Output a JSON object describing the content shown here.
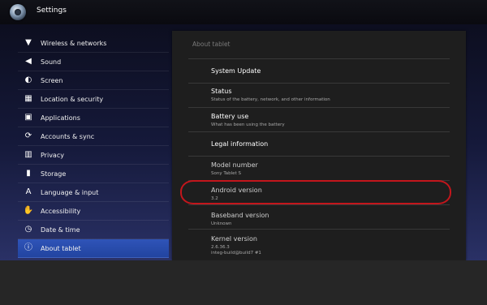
{
  "app": {
    "title": "Settings",
    "icon": "settings-gear-icon"
  },
  "sidebar": {
    "items": [
      {
        "label": "Wireless & networks",
        "icon": "wifi-icon",
        "glyph": "▼"
      },
      {
        "label": "Sound",
        "icon": "speaker-icon",
        "glyph": "◀"
      },
      {
        "label": "Screen",
        "icon": "brightness-icon",
        "glyph": "◐"
      },
      {
        "label": "Location & security",
        "icon": "location-grid-icon",
        "glyph": "▦"
      },
      {
        "label": "Applications",
        "icon": "applications-icon",
        "glyph": "▣"
      },
      {
        "label": "Accounts & sync",
        "icon": "sync-icon",
        "glyph": "⟳"
      },
      {
        "label": "Privacy",
        "icon": "privacy-icon",
        "glyph": "▥"
      },
      {
        "label": "Storage",
        "icon": "storage-icon",
        "glyph": "▮"
      },
      {
        "label": "Language & input",
        "icon": "language-icon",
        "glyph": "A"
      },
      {
        "label": "Accessibility",
        "icon": "hand-icon",
        "glyph": "✋"
      },
      {
        "label": "Date & time",
        "icon": "clock-icon",
        "glyph": "◷"
      },
      {
        "label": "About tablet",
        "icon": "info-icon",
        "glyph": "ⓘ",
        "selected": true
      }
    ]
  },
  "panel": {
    "header": "About tablet",
    "prefs": [
      {
        "title": "System Update",
        "summary": ""
      },
      {
        "title": "Status",
        "summary": "Status of the battery, network, and other information"
      },
      {
        "title": "Battery use",
        "summary": "What has been using the battery"
      },
      {
        "title": "Legal information",
        "summary": ""
      },
      {
        "title": "Model number",
        "summary": "Sony Tablet S"
      },
      {
        "title": "Android version",
        "summary": "3.2"
      },
      {
        "title": "Baseband version",
        "summary": "Unknown"
      },
      {
        "title": "Kernel version",
        "summary": "2.6.36.3",
        "summary2": "integ-build@build7 #1"
      }
    ]
  },
  "colors": {
    "selected": "#2a4caf",
    "highlight_ring": "#c3161c"
  }
}
